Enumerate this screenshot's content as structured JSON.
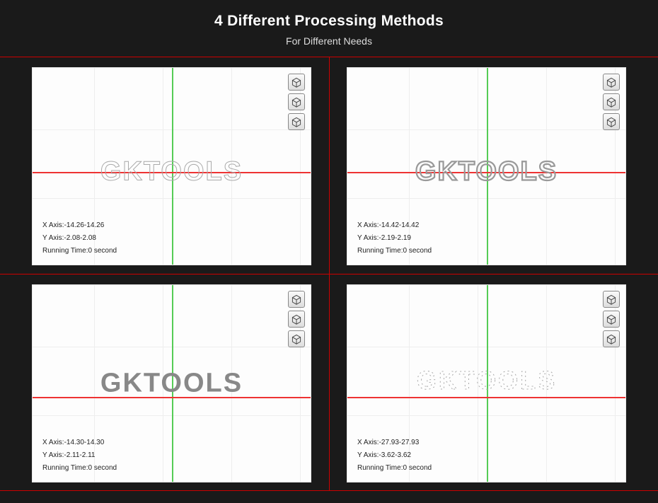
{
  "header": {
    "title": "4 Different Processing Methods",
    "subtitle": "For Different Needs"
  },
  "logo_text": "GKTOOLS",
  "panels": {
    "tl": {
      "xaxis": "X Axis:-14.26-14.26",
      "yaxis": "Y Axis:-2.08-2.08",
      "runtime": "Running Time:0 second"
    },
    "tr": {
      "xaxis": "X Axis:-14.42-14.42",
      "yaxis": "Y Axis:-2.19-2.19",
      "runtime": "Running Time:0 second"
    },
    "bl": {
      "xaxis": "X Axis:-14.30-14.30",
      "yaxis": "Y Axis:-2.11-2.11",
      "runtime": "Running Time:0 second"
    },
    "br": {
      "xaxis": "X Axis:-27.93-27.93",
      "yaxis": "Y Axis:-3.62-3.62",
      "runtime": "Running Time:0 second"
    }
  }
}
